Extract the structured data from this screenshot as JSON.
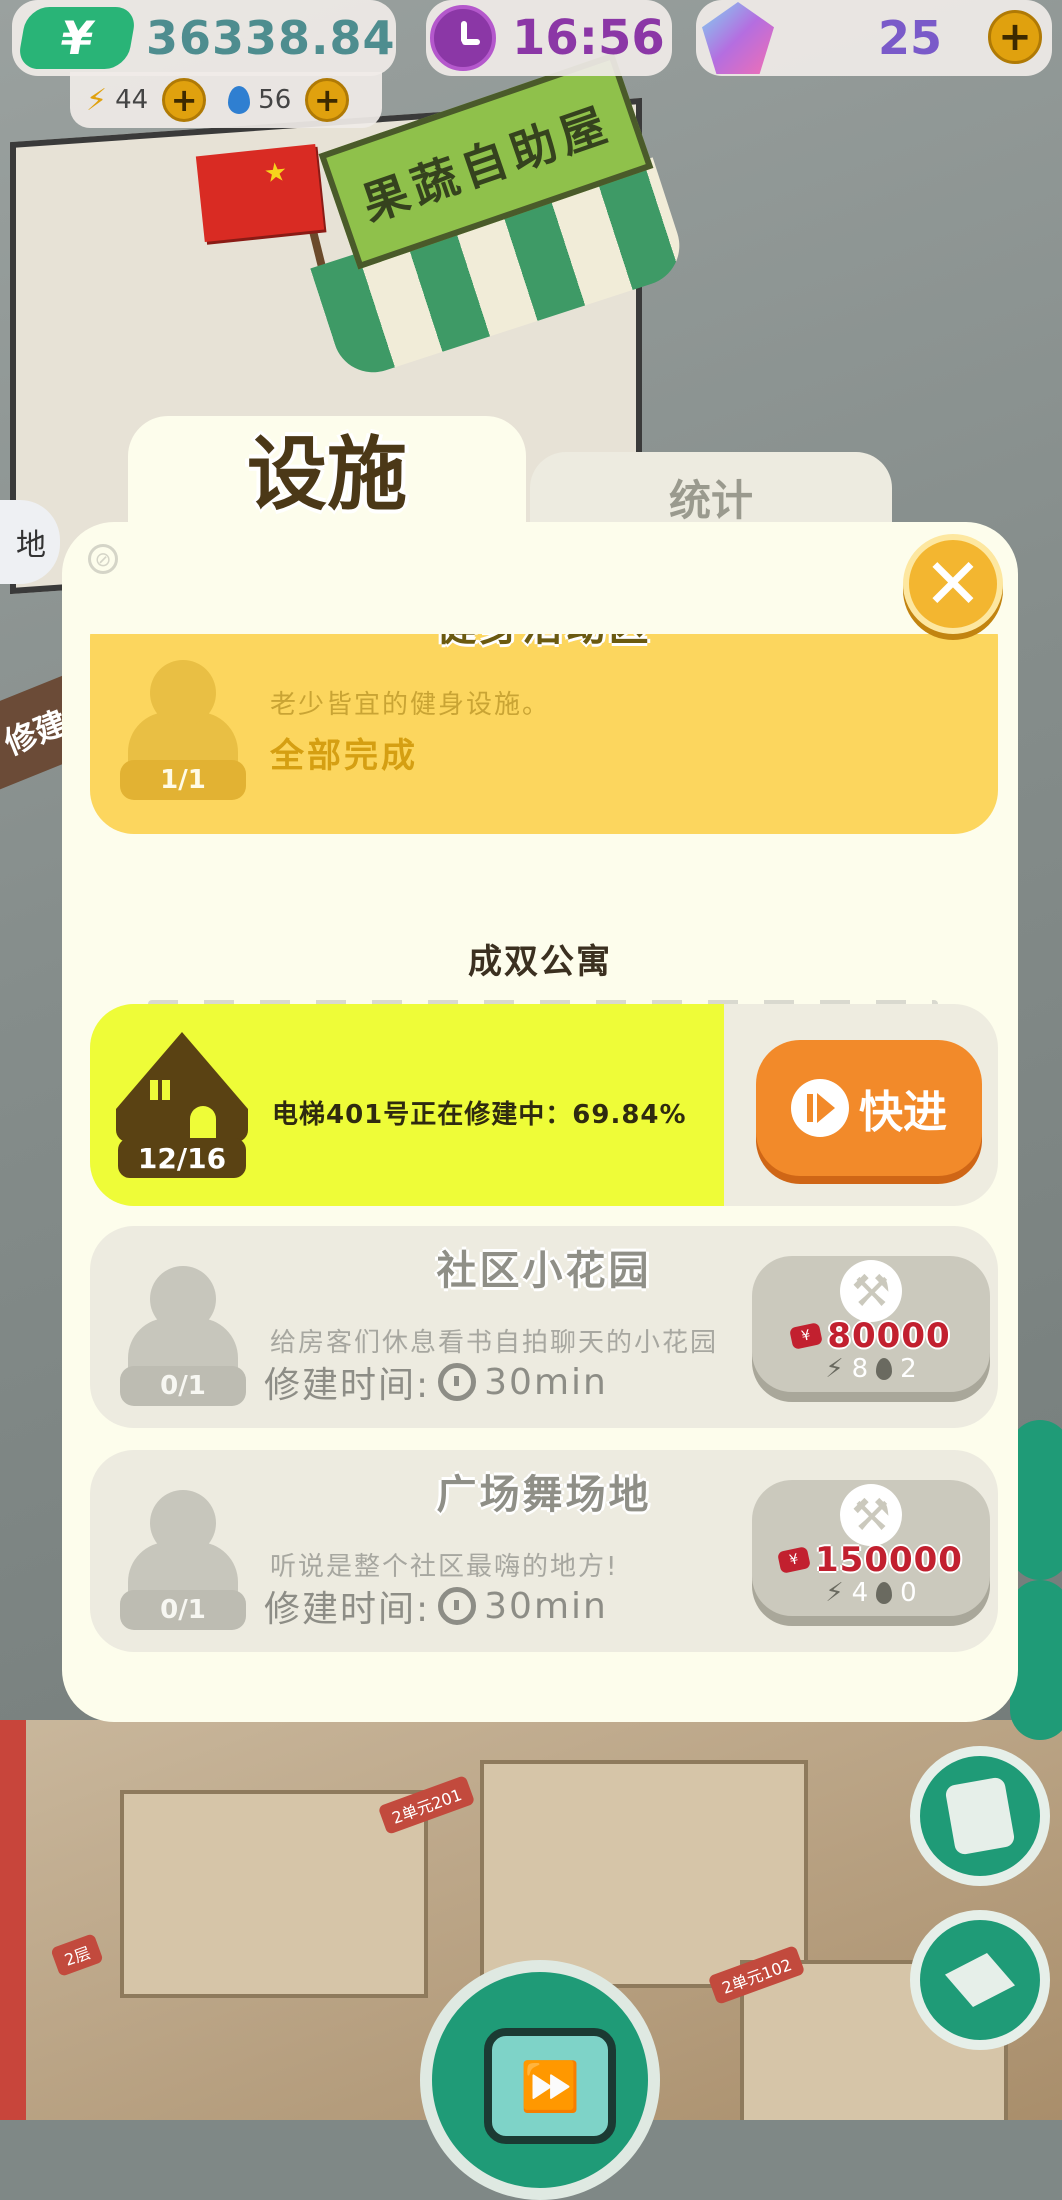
{
  "hud": {
    "money": "36338.84",
    "money_symbol": "¥",
    "time": "16:56",
    "gems": "25",
    "energy": "44",
    "water": "56",
    "plus": "+"
  },
  "scene": {
    "shop_sign": "果蔬自助屋",
    "side_label": "地",
    "repair_label": "修建",
    "unit_tags": [
      "2单元201",
      "2单元102",
      "2层"
    ]
  },
  "tabs": {
    "active": "设施",
    "inactive": "统计"
  },
  "close_symbol": "✕",
  "items": {
    "fitness": {
      "title": "健身活动区",
      "desc": "老少皆宜的健身设施。",
      "count": "1/1",
      "status": "全部完成"
    },
    "section_title": "成双公寓",
    "elevator": {
      "count": "12/16",
      "progress_text": "电梯401号正在修建中：69.84%",
      "progress": 0.6984,
      "button": "快进"
    },
    "garden": {
      "title": "社区小花园",
      "desc": "给房客们休息看书自拍聊天的小花园",
      "count": "0/1",
      "build_time_label": "修建时间:",
      "build_time": "30min",
      "cost": "80000",
      "energy": "8",
      "water": "2"
    },
    "dance": {
      "title": "广场舞场地",
      "desc": "听说是整个社区最嗨的地方!",
      "count": "0/1",
      "build_time_label": "修建时间:",
      "build_time": "30min",
      "cost": "150000",
      "energy": "4",
      "water": "0"
    }
  },
  "colors": {
    "accent_orange": "#f28a2a",
    "progress_yellow": "#eefc38",
    "panel_bg": "#fdfdec",
    "completed_yellow": "#fcd65e",
    "game_green": "#1f9b77"
  }
}
